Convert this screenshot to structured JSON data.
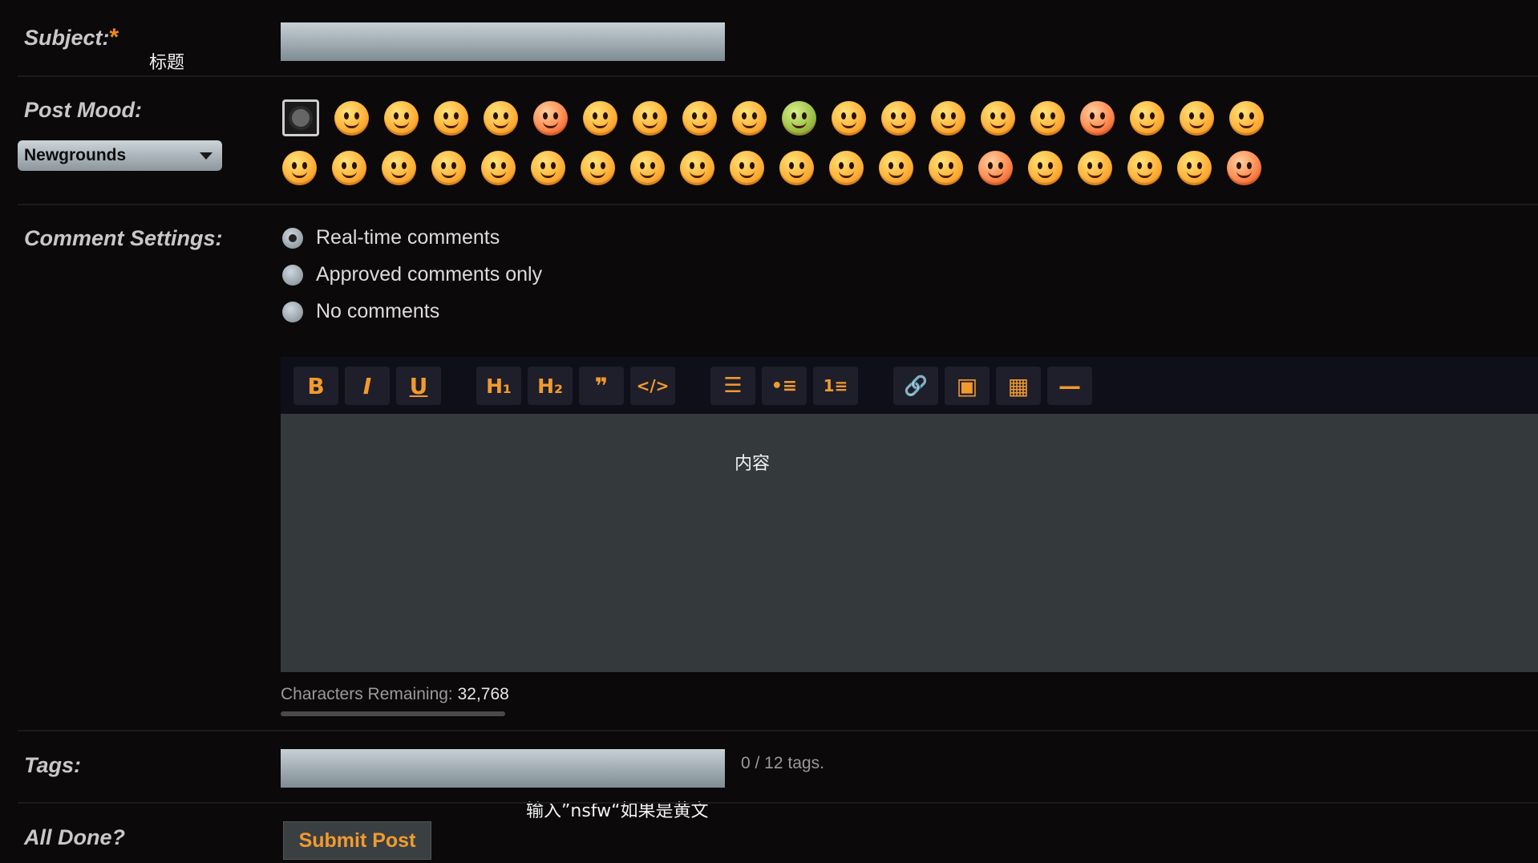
{
  "form": {
    "subject_label": "Subject:",
    "required_mark": "*",
    "subject_annotation": "标题",
    "mood_label": "Post Mood:",
    "mood_select_value": "Newgrounds",
    "comment_label": "Comment Settings:",
    "comment_options": [
      "Real-time comments",
      "Approved comments only",
      "No comments"
    ],
    "comment_selected": "Real-time comments",
    "tags_label": "Tags:",
    "tags_annotation": "输入”nsfw“如果是黄文",
    "tags_count": "0  / 12 tags.",
    "done_label": "All Done?",
    "submit_label": "Submit Post"
  },
  "editor": {
    "toolbar": {
      "bold": "B",
      "italic": "I",
      "underline": "U",
      "h1": "H₁",
      "h2": "H₂",
      "quote": "❞",
      "code": "</>",
      "align": "☰",
      "bullets": "•≡",
      "numbers": "1≡",
      "link": "🔗",
      "image": "▣",
      "video": "▦",
      "rule": "—"
    },
    "content_annotation": "内容",
    "chars_remaining_label": "Characters Remaining:",
    "chars_remaining_value": "32,768"
  },
  "colors": {
    "accent": "#f29a2e",
    "background": "#0b0909",
    "editor_bg": "#343a3c"
  }
}
